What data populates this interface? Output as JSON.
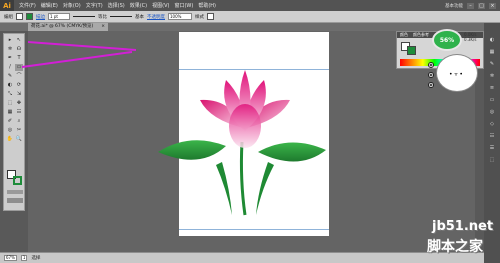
{
  "menubar": {
    "logo": "Ai",
    "items": [
      "文件(F)",
      "编辑(E)",
      "对象(O)",
      "文字(T)",
      "选择(S)",
      "效果(C)",
      "视图(V)",
      "窗口(W)",
      "帮助(H)"
    ],
    "workspace": "基本功能",
    "window_buttons": [
      "–",
      "□",
      "×"
    ]
  },
  "control_bar": {
    "group_label": "编组",
    "stroke_label": "描边",
    "stroke_value": "1 pt",
    "profile_label": "等比",
    "brush_label": "基本",
    "opacity_link": "不透明度",
    "opacity_value": "100%",
    "style_label": "样式",
    "fill_color": "#ffffff",
    "stroke_color": "#1e8c3a"
  },
  "document_tab": {
    "title": "荷花.ai* @ 67% (CMYK/预览)",
    "close": "×"
  },
  "toolbox": {
    "tools": [
      "▸",
      "↖",
      "✲",
      "☊",
      "✒",
      "T",
      "/",
      "▭",
      "✎",
      "⌒",
      "◐",
      "⟳",
      "⤡",
      "⇲",
      "⬚",
      "✥",
      "▦",
      "☷",
      "✐",
      "⌕",
      "◎",
      "✂",
      "✋",
      "🔍"
    ],
    "fill_color": "#ffffff",
    "stroke_color": "#1e8c3a"
  },
  "color_panel": {
    "tabs": [
      "颜色",
      "颜色参考"
    ],
    "accent": "#d0257a"
  },
  "network_widget": {
    "percent": "56%",
    "up": "0.0K/s",
    "down": "0.3K/s"
  },
  "status_bar": {
    "zoom": "67%",
    "page": "1",
    "mode": "选择"
  },
  "watermark": {
    "site": "jb51.net",
    "text": "脚本之家"
  }
}
